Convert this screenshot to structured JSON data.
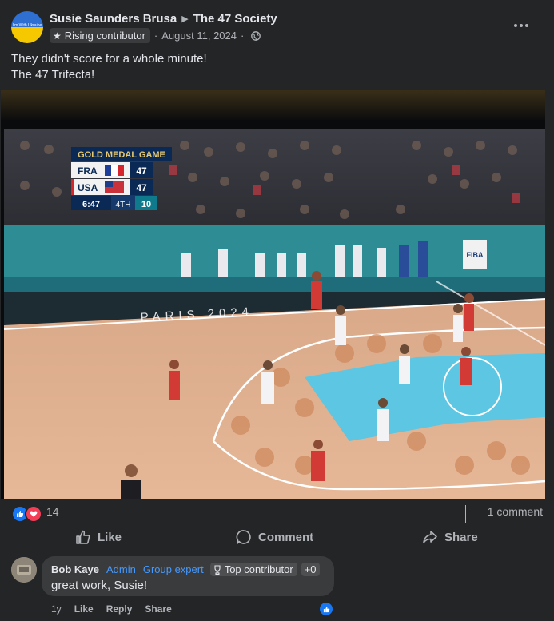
{
  "post": {
    "author": "Susie Saunders Brusa",
    "group": "The 47 Society",
    "badge": "Rising contributor",
    "date": "August 11, 2024",
    "avatar_text": "I'm With Ukraine",
    "text_line1": "They didn't score for a whole minute!",
    "text_line2": "The 47 Trifecta!"
  },
  "scoreboard": {
    "title": "GOLD MEDAL GAME",
    "team1": "FRA",
    "score1": "47",
    "team2": "USA",
    "score2": "47",
    "clock": "6:47",
    "period": "4TH",
    "shot_clock": "10",
    "venue_text": "PARIS 2024",
    "sponsor": "FIBA"
  },
  "reactions": {
    "count": "14",
    "comments": "1 comment"
  },
  "actions": {
    "like": "Like",
    "comment": "Comment",
    "share": "Share"
  },
  "comment": {
    "author": "Bob Kaye",
    "role": "Admin",
    "expert": "Group expert",
    "top": "Top contributor",
    "plus": "+0",
    "text": "great work, Susie!",
    "age": "1y",
    "like": "Like",
    "reply": "Reply",
    "share": "Share"
  },
  "colors": {
    "background": "#242526",
    "text_primary": "#e4e6eb",
    "text_secondary": "#b0b3b8",
    "accent_blue": "#1877f2",
    "love_red": "#f33e58"
  },
  "icons": [
    "more-icon",
    "globe-icon",
    "star-icon",
    "like-icon",
    "love-icon",
    "comment-icon",
    "share-icon",
    "trophy-icon"
  ]
}
